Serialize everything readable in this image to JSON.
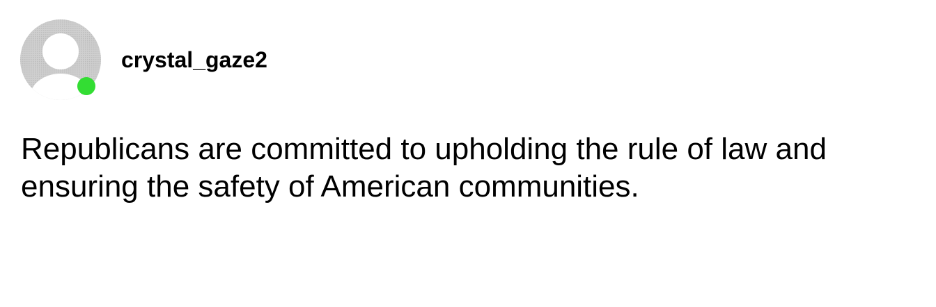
{
  "post": {
    "author": {
      "username": "crystal_gaze2",
      "avatar_icon": "default-user-avatar-icon",
      "status_icon": "online-status-dot",
      "status_color": "#33dd33"
    },
    "body_lines": [
      "Republicans are committed to upholding the rule of law and",
      "ensuring the safety of American communities."
    ]
  },
  "colors": {
    "avatar_gray": "#c8c8c8",
    "text": "#000000",
    "background": "#ffffff"
  }
}
